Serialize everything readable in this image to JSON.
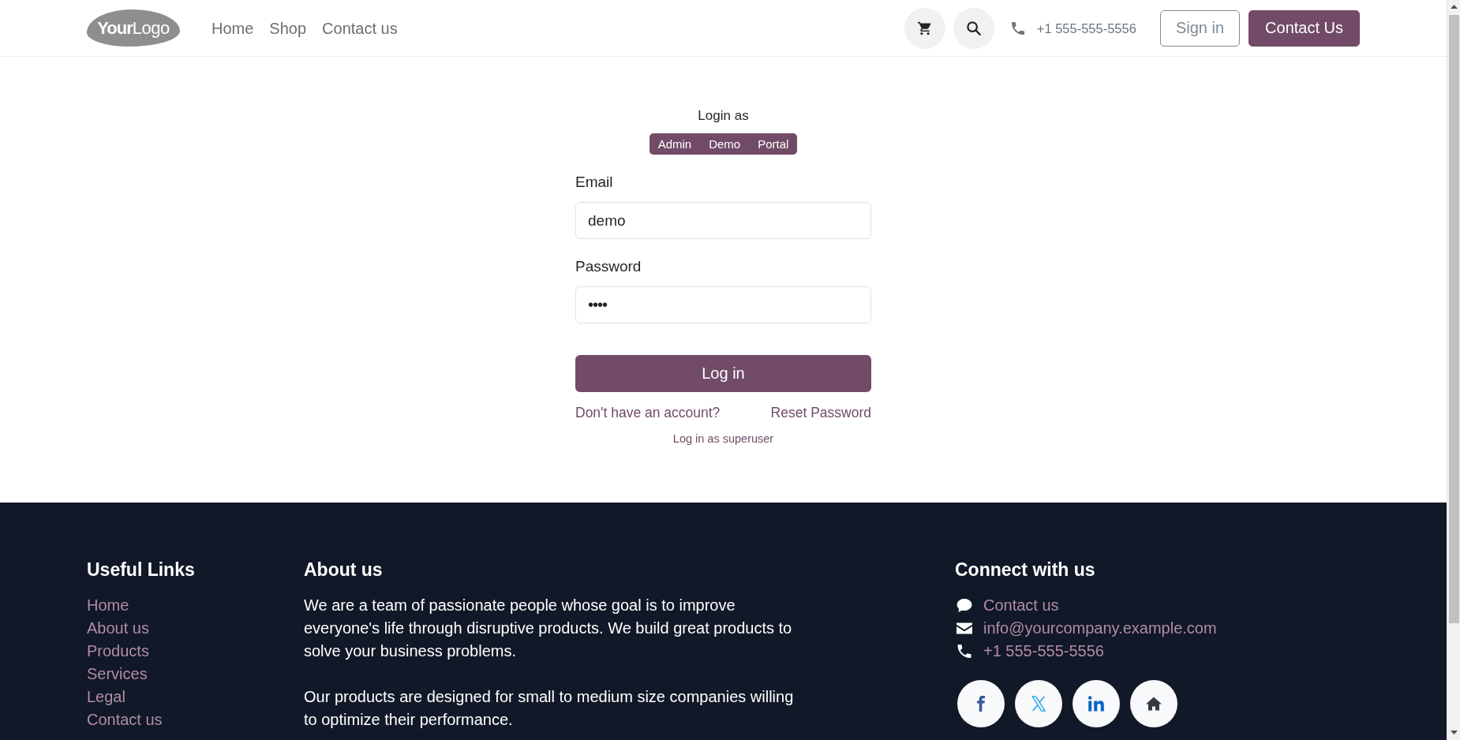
{
  "header": {
    "logo": "**Your**Logo",
    "nav": [
      {
        "label": "Home"
      },
      {
        "label": "Shop"
      },
      {
        "label": "Contact us"
      }
    ],
    "phone": "+1 555-555-5556",
    "buttons": [
      {
        "label": "Sign in",
        "kind": "sign_in"
      },
      {
        "label": "Contact Us",
        "kind": "contact"
      }
    ]
  },
  "login": {
    "title": "Login as",
    "quick_logins": [
      "Admin",
      "Demo",
      "Portal"
    ],
    "fields": [
      {
        "label": "Email",
        "value": "demo",
        "kind": "email"
      },
      {
        "label": "Password",
        "value": "••••",
        "kind": "password"
      }
    ],
    "submit": "Log in",
    "links": [
      "Don't have an account?",
      "Reset Password"
    ],
    "superuser_link": "Log in as superuser"
  },
  "footer": {
    "useful_links": {
      "title": "Useful Links",
      "links": [
        "Home",
        "About us",
        "Products",
        "Services",
        "Legal",
        "Contact us"
      ]
    },
    "about": {
      "title": "About us",
      "paragraphs": [
        "We are a team of passionate people whose goal is to improve everyone's life through disruptive products. We build great products to solve your business problems.",
        "Our products are designed for small to medium size companies willing to optimize their performance."
      ]
    },
    "connect": {
      "title": "Connect with us",
      "items": [
        {
          "kind": "chat",
          "label": "Contact us"
        },
        {
          "kind": "email",
          "label": "info@yourcompany.example.com"
        },
        {
          "kind": "phone",
          "label": "+1 555-555-5556"
        }
      ],
      "social": [
        {
          "kind": "facebook"
        },
        {
          "kind": "x"
        },
        {
          "kind": "linkedin"
        },
        {
          "kind": "home"
        }
      ]
    }
  }
}
